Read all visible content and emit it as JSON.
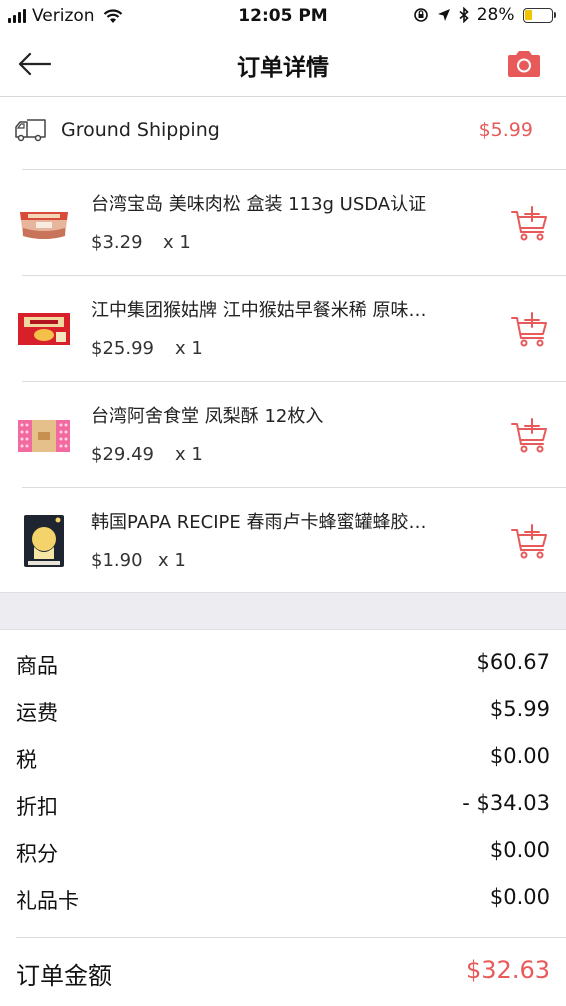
{
  "status_bar": {
    "carrier": "Verizon",
    "time": "12:05 PM",
    "battery": "28%",
    "battery_level": 0.28
  },
  "nav": {
    "title": "订单详情"
  },
  "shipping": {
    "label": "Ground Shipping",
    "price": "$5.99"
  },
  "items": [
    {
      "title": "台湾宝岛 美味肉松 盒装 113g USDA认证",
      "price": "$3.29",
      "qty": "x 1",
      "image": "meat-floss-box"
    },
    {
      "title": "江中集团猴姑牌 江中猴姑早餐米稀 原味…",
      "price": "$25.99",
      "qty": "x 1",
      "image": "rice-cereal-box"
    },
    {
      "title": "台湾阿舍食堂 凤梨酥 12枚入",
      "price": "$29.49",
      "qty": "x 1",
      "image": "pineapple-cake-box"
    },
    {
      "title": "韩国PAPA RECIPE 春雨卢卡蜂蜜罐蜂胶…",
      "price": "$1.90",
      "qty": "x 1",
      "image": "honey-mask-pack"
    }
  ],
  "summary": {
    "rows": [
      {
        "label": "商品",
        "value": "$60.67"
      },
      {
        "label": "运费",
        "value": "$5.99"
      },
      {
        "label": "税",
        "value": "$0.00"
      },
      {
        "label": "折扣",
        "value": "- $34.03"
      },
      {
        "label": "积分",
        "value": "$0.00"
      },
      {
        "label": "礼品卡",
        "value": "$0.00"
      }
    ],
    "total_label": "订单金额",
    "total_value": "$32.63"
  },
  "colors": {
    "accent": "#e85a5a",
    "battery": "#f2c400"
  }
}
